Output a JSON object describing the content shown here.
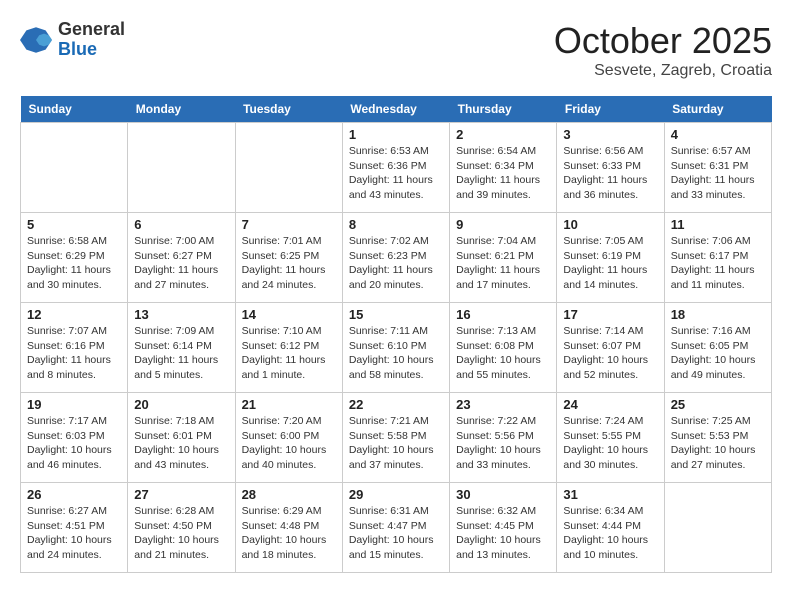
{
  "header": {
    "logo": {
      "general": "General",
      "blue": "Blue"
    },
    "title": "October 2025",
    "location": "Sesvete, Zagreb, Croatia"
  },
  "calendar": {
    "days_of_week": [
      "Sunday",
      "Monday",
      "Tuesday",
      "Wednesday",
      "Thursday",
      "Friday",
      "Saturday"
    ],
    "weeks": [
      [
        {
          "day": "",
          "info": ""
        },
        {
          "day": "",
          "info": ""
        },
        {
          "day": "",
          "info": ""
        },
        {
          "day": "1",
          "sunrise": "Sunrise: 6:53 AM",
          "sunset": "Sunset: 6:36 PM",
          "daylight": "Daylight: 11 hours and 43 minutes."
        },
        {
          "day": "2",
          "sunrise": "Sunrise: 6:54 AM",
          "sunset": "Sunset: 6:34 PM",
          "daylight": "Daylight: 11 hours and 39 minutes."
        },
        {
          "day": "3",
          "sunrise": "Sunrise: 6:56 AM",
          "sunset": "Sunset: 6:33 PM",
          "daylight": "Daylight: 11 hours and 36 minutes."
        },
        {
          "day": "4",
          "sunrise": "Sunrise: 6:57 AM",
          "sunset": "Sunset: 6:31 PM",
          "daylight": "Daylight: 11 hours and 33 minutes."
        }
      ],
      [
        {
          "day": "5",
          "sunrise": "Sunrise: 6:58 AM",
          "sunset": "Sunset: 6:29 PM",
          "daylight": "Daylight: 11 hours and 30 minutes."
        },
        {
          "day": "6",
          "sunrise": "Sunrise: 7:00 AM",
          "sunset": "Sunset: 6:27 PM",
          "daylight": "Daylight: 11 hours and 27 minutes."
        },
        {
          "day": "7",
          "sunrise": "Sunrise: 7:01 AM",
          "sunset": "Sunset: 6:25 PM",
          "daylight": "Daylight: 11 hours and 24 minutes."
        },
        {
          "day": "8",
          "sunrise": "Sunrise: 7:02 AM",
          "sunset": "Sunset: 6:23 PM",
          "daylight": "Daylight: 11 hours and 20 minutes."
        },
        {
          "day": "9",
          "sunrise": "Sunrise: 7:04 AM",
          "sunset": "Sunset: 6:21 PM",
          "daylight": "Daylight: 11 hours and 17 minutes."
        },
        {
          "day": "10",
          "sunrise": "Sunrise: 7:05 AM",
          "sunset": "Sunset: 6:19 PM",
          "daylight": "Daylight: 11 hours and 14 minutes."
        },
        {
          "day": "11",
          "sunrise": "Sunrise: 7:06 AM",
          "sunset": "Sunset: 6:17 PM",
          "daylight": "Daylight: 11 hours and 11 minutes."
        }
      ],
      [
        {
          "day": "12",
          "sunrise": "Sunrise: 7:07 AM",
          "sunset": "Sunset: 6:16 PM",
          "daylight": "Daylight: 11 hours and 8 minutes."
        },
        {
          "day": "13",
          "sunrise": "Sunrise: 7:09 AM",
          "sunset": "Sunset: 6:14 PM",
          "daylight": "Daylight: 11 hours and 5 minutes."
        },
        {
          "day": "14",
          "sunrise": "Sunrise: 7:10 AM",
          "sunset": "Sunset: 6:12 PM",
          "daylight": "Daylight: 11 hours and 1 minute."
        },
        {
          "day": "15",
          "sunrise": "Sunrise: 7:11 AM",
          "sunset": "Sunset: 6:10 PM",
          "daylight": "Daylight: 10 hours and 58 minutes."
        },
        {
          "day": "16",
          "sunrise": "Sunrise: 7:13 AM",
          "sunset": "Sunset: 6:08 PM",
          "daylight": "Daylight: 10 hours and 55 minutes."
        },
        {
          "day": "17",
          "sunrise": "Sunrise: 7:14 AM",
          "sunset": "Sunset: 6:07 PM",
          "daylight": "Daylight: 10 hours and 52 minutes."
        },
        {
          "day": "18",
          "sunrise": "Sunrise: 7:16 AM",
          "sunset": "Sunset: 6:05 PM",
          "daylight": "Daylight: 10 hours and 49 minutes."
        }
      ],
      [
        {
          "day": "19",
          "sunrise": "Sunrise: 7:17 AM",
          "sunset": "Sunset: 6:03 PM",
          "daylight": "Daylight: 10 hours and 46 minutes."
        },
        {
          "day": "20",
          "sunrise": "Sunrise: 7:18 AM",
          "sunset": "Sunset: 6:01 PM",
          "daylight": "Daylight: 10 hours and 43 minutes."
        },
        {
          "day": "21",
          "sunrise": "Sunrise: 7:20 AM",
          "sunset": "Sunset: 6:00 PM",
          "daylight": "Daylight: 10 hours and 40 minutes."
        },
        {
          "day": "22",
          "sunrise": "Sunrise: 7:21 AM",
          "sunset": "Sunset: 5:58 PM",
          "daylight": "Daylight: 10 hours and 37 minutes."
        },
        {
          "day": "23",
          "sunrise": "Sunrise: 7:22 AM",
          "sunset": "Sunset: 5:56 PM",
          "daylight": "Daylight: 10 hours and 33 minutes."
        },
        {
          "day": "24",
          "sunrise": "Sunrise: 7:24 AM",
          "sunset": "Sunset: 5:55 PM",
          "daylight": "Daylight: 10 hours and 30 minutes."
        },
        {
          "day": "25",
          "sunrise": "Sunrise: 7:25 AM",
          "sunset": "Sunset: 5:53 PM",
          "daylight": "Daylight: 10 hours and 27 minutes."
        }
      ],
      [
        {
          "day": "26",
          "sunrise": "Sunrise: 6:27 AM",
          "sunset": "Sunset: 4:51 PM",
          "daylight": "Daylight: 10 hours and 24 minutes."
        },
        {
          "day": "27",
          "sunrise": "Sunrise: 6:28 AM",
          "sunset": "Sunset: 4:50 PM",
          "daylight": "Daylight: 10 hours and 21 minutes."
        },
        {
          "day": "28",
          "sunrise": "Sunrise: 6:29 AM",
          "sunset": "Sunset: 4:48 PM",
          "daylight": "Daylight: 10 hours and 18 minutes."
        },
        {
          "day": "29",
          "sunrise": "Sunrise: 6:31 AM",
          "sunset": "Sunset: 4:47 PM",
          "daylight": "Daylight: 10 hours and 15 minutes."
        },
        {
          "day": "30",
          "sunrise": "Sunrise: 6:32 AM",
          "sunset": "Sunset: 4:45 PM",
          "daylight": "Daylight: 10 hours and 13 minutes."
        },
        {
          "day": "31",
          "sunrise": "Sunrise: 6:34 AM",
          "sunset": "Sunset: 4:44 PM",
          "daylight": "Daylight: 10 hours and 10 minutes."
        },
        {
          "day": "",
          "info": ""
        }
      ]
    ]
  }
}
